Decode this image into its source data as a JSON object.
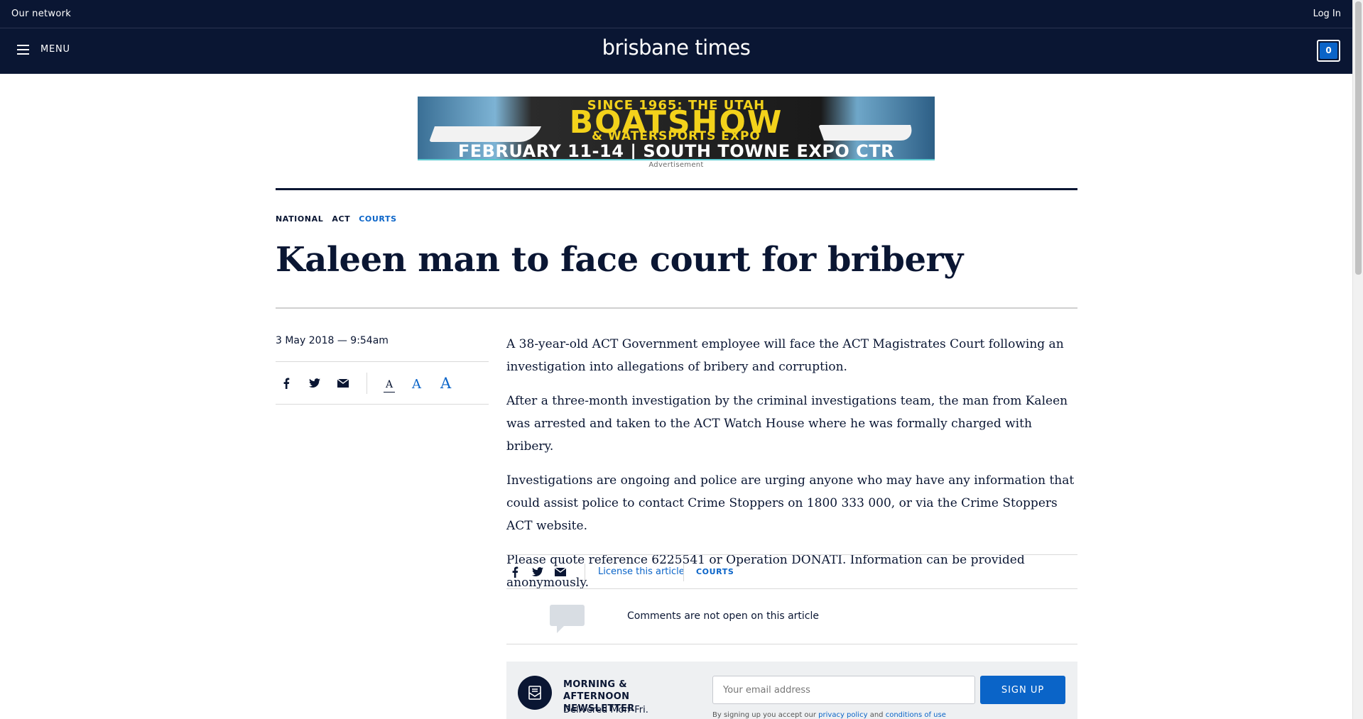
{
  "network_bar": {
    "our_network": "Our network",
    "login": "Log In"
  },
  "header": {
    "menu_label": "MENU",
    "logo": "brisbane times",
    "cart_count": "0"
  },
  "ad": {
    "top_line": "SINCE 1965: THE UTAH",
    "main_line": "BOATSHOW",
    "sub_line": "& WATERSPORTS EXPO",
    "bottom_line": "FEBRUARY 11-14  |  SOUTH TOWNE EXPO CTR",
    "label": "Advertisement"
  },
  "breadcrumb": [
    {
      "label": "NATIONAL",
      "active": false
    },
    {
      "label": "ACT",
      "active": false
    },
    {
      "label": "COURTS",
      "active": true
    }
  ],
  "article": {
    "headline": "Kaleen man to face court for bribery",
    "dateline": "3 May 2018 — 9:54am",
    "paragraphs": [
      "A 38-year-old ACT Government employee will face the ACT Magistrates Court following an investigation into allegations of bribery and corruption.",
      "After a three-month investigation by the criminal investigations team, the man from Kaleen was arrested and taken to the ACT Watch House where he was formally charged with bribery.",
      "Investigations are ongoing and police are urging anyone who may have any information that could assist police to contact Crime Stoppers on 1800 333 000, or via the Crime Stoppers ACT website.",
      "Please quote reference 6225541 or Operation DONATI. Information can be provided anonymously."
    ]
  },
  "tools": {
    "icons": [
      "facebook-icon",
      "twitter-icon",
      "email-icon"
    ],
    "font_size_glyph": "A"
  },
  "footer": {
    "license": "License this article",
    "tag": "COURTS",
    "comments": "Comments are not open on this article"
  },
  "newsletter": {
    "title": "MORNING & AFTERNOON NEWSLETTER",
    "subtitle": "Delivered Mon–Fri.",
    "placeholder": "Your email address",
    "button": "SIGN UP",
    "legal_prefix": "By signing up you accept our",
    "privacy": "privacy policy",
    "legal_and": "and",
    "conditions": "conditions of use"
  },
  "colors": {
    "navy": "#0a1633",
    "accent": "#0a64c8"
  }
}
